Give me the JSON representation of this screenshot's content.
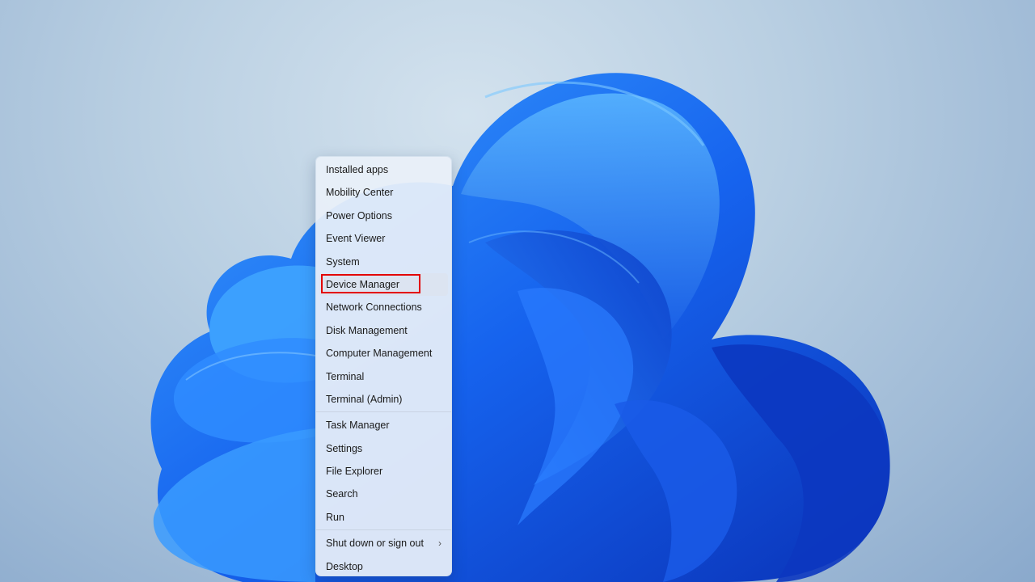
{
  "start_menu_context": {
    "group1": [
      {
        "label": "Installed apps"
      },
      {
        "label": "Mobility Center"
      },
      {
        "label": "Power Options"
      },
      {
        "label": "Event Viewer"
      },
      {
        "label": "System"
      },
      {
        "label": "Device Manager",
        "highlighted": true
      },
      {
        "label": "Network Connections"
      },
      {
        "label": "Disk Management"
      },
      {
        "label": "Computer Management"
      },
      {
        "label": "Terminal"
      },
      {
        "label": "Terminal (Admin)"
      }
    ],
    "group2": [
      {
        "label": "Task Manager"
      },
      {
        "label": "Settings"
      },
      {
        "label": "File Explorer"
      },
      {
        "label": "Search"
      },
      {
        "label": "Run"
      }
    ],
    "group3": [
      {
        "label": "Shut down or sign out",
        "submenu_icon": "chevron-right-icon"
      },
      {
        "label": "Desktop"
      }
    ]
  },
  "colors": {
    "highlight_border": "#e30000",
    "wallpaper_accent": "#1565e8"
  }
}
